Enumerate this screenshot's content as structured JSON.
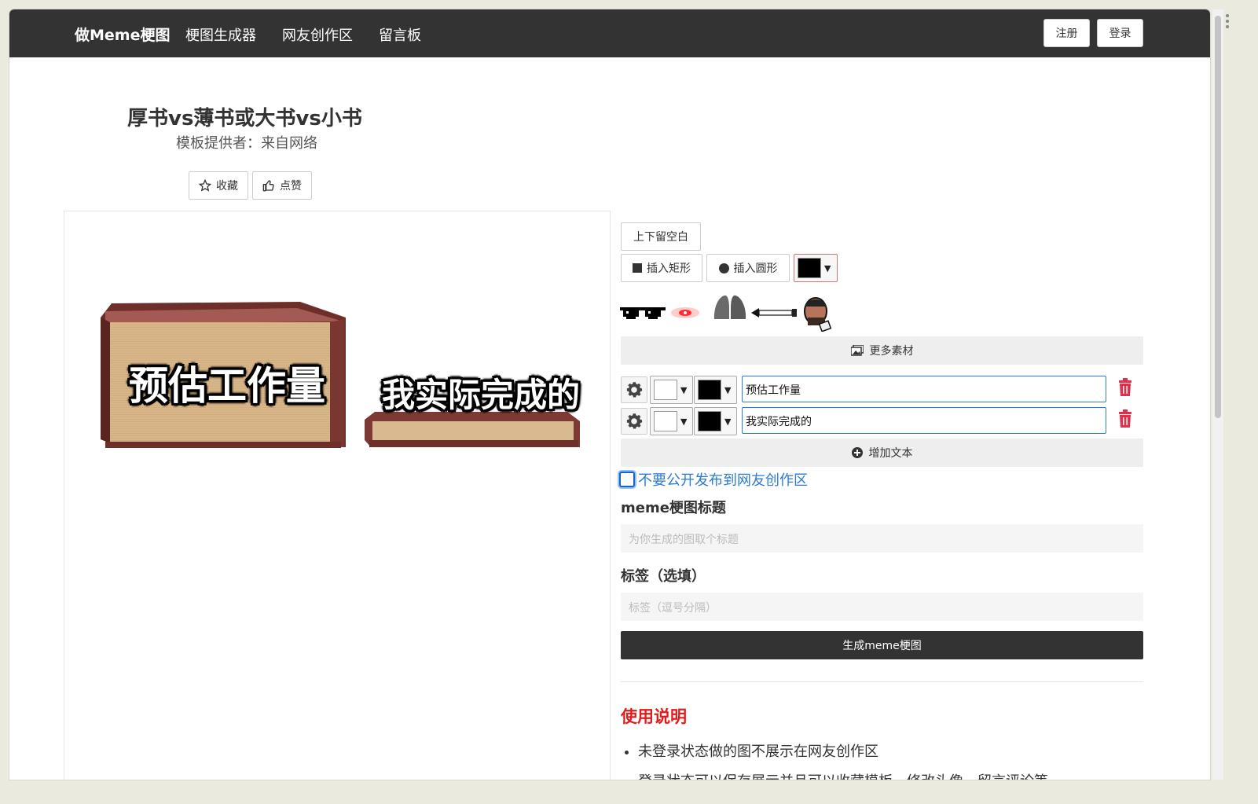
{
  "nav": {
    "brand": "做Meme梗图",
    "links": [
      "梗图生成器",
      "网友创作区",
      "留言板"
    ],
    "register": "注册",
    "login": "登录"
  },
  "template": {
    "title": "厚书vs薄书或大书vs小书",
    "author": "模板提供者：来自网络",
    "favorite": "收藏",
    "like": "点赞"
  },
  "meme": {
    "texts": [
      "预估工作量",
      "我实际完成的"
    ]
  },
  "tools": {
    "padding_btn": "上下留空白",
    "insert_rect": "插入矩形",
    "insert_circle": "插入圆形",
    "shape_color": "#000000",
    "more_assets": "更多素材",
    "add_text": "增加文本"
  },
  "text_rows": [
    {
      "value": "预估工作量",
      "fill": "#ffffff",
      "stroke": "#000000"
    },
    {
      "value": "我实际完成的",
      "fill": "#ffffff",
      "stroke": "#000000"
    }
  ],
  "form": {
    "private_label": "不要公开发布到网友创作区",
    "title_label": "meme梗图标题",
    "title_placeholder": "为你生成的图取个标题",
    "tags_label": "标签（选填）",
    "tags_placeholder": "标签（逗号分隔）",
    "generate": "生成meme梗图"
  },
  "help": {
    "title": "使用说明",
    "items": [
      "未登录状态做的图不展示在网友创作区",
      "登录状态可以保存展示并且可以收藏模板、修改头像、留言评论等"
    ]
  },
  "colors": {
    "navbar": "#333333",
    "accent": "#2a7ad6",
    "danger": "#e41b1b"
  }
}
